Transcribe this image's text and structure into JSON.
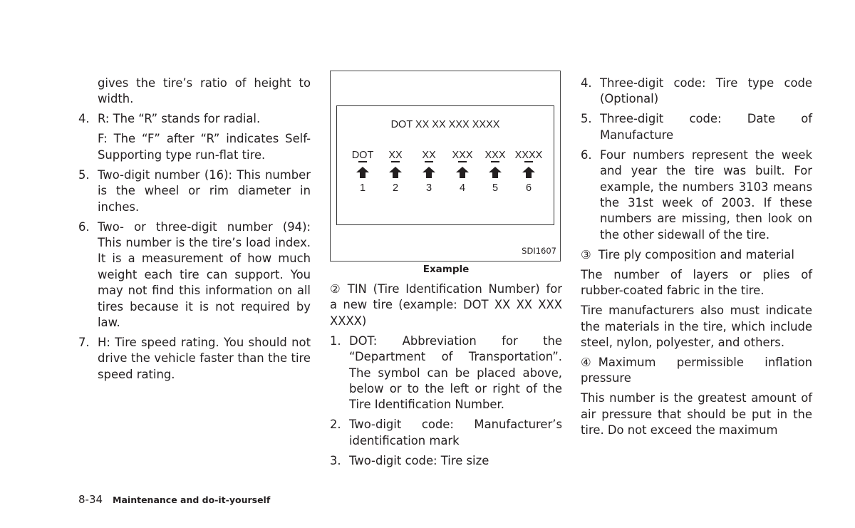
{
  "left_column": {
    "intro_continuation": "gives the tire’s ratio of height to width.",
    "items": [
      {
        "num": "4.",
        "text": "R: The “R” stands for radial.",
        "extra": "F: The “F” after “R” indicates Self-Supporting type run-flat tire."
      },
      {
        "num": "5.",
        "text": "Two-digit number (16): This number is the wheel or rim diameter in inches."
      },
      {
        "num": "6.",
        "text": "Two- or three-digit number (94): This number is the tire’s load index. It is a measurement of how much weight each tire can support. You may not find this information on all tires because it is not required by law."
      },
      {
        "num": "7.",
        "text": "H: Tire speed rating. You should not drive the vehicle faster than the tire speed rating."
      }
    ]
  },
  "figure": {
    "code_line": "DOT XX XX XXX XXXX",
    "segments": [
      {
        "label": "DOT",
        "num": "1",
        "icon": "up-arrow-icon"
      },
      {
        "label": "XX",
        "num": "2",
        "icon": "up-arrow-icon"
      },
      {
        "label": "XX",
        "num": "3",
        "icon": "up-arrow-icon"
      },
      {
        "label": "XXX",
        "num": "4",
        "icon": "up-arrow-icon"
      },
      {
        "label": "XXX",
        "num": "5",
        "icon": "up-arrow-icon"
      },
      {
        "label": "XXXX",
        "num": "6",
        "icon": "up-arrow-icon"
      }
    ],
    "figure_id": "SDI1607",
    "caption": "Example"
  },
  "middle_column": {
    "heading_marker": "②",
    "heading": "TIN (Tire Identification Number) for a new tire (example: DOT XX XX XXX XXXX)",
    "items": [
      {
        "num": "1.",
        "text": "DOT: Abbreviation for the “Department of Transportation”. The symbol can be placed above, below or to the left or right of the Tire Identification Number."
      },
      {
        "num": "2.",
        "text": "Two-digit code: Manufacturer’s identification mark"
      },
      {
        "num": "3.",
        "text": "Two-digit code: Tire size"
      }
    ]
  },
  "right_column": {
    "items": [
      {
        "num": "4.",
        "text": "Three-digit code: Tire type code (Optional)"
      },
      {
        "num": "5.",
        "text": "Three-digit code: Date of Manufacture"
      },
      {
        "num": "6.",
        "text": "Four numbers represent the week and year the tire was built. For example, the numbers 3103 means the 31st week of 2003. If these numbers are missing, then look on the other sidewall of the tire."
      }
    ],
    "section3": {
      "marker": "③",
      "heading": "Tire ply composition and material",
      "paragraphs": [
        "The number of layers or plies of rubber-coated fabric in the tire.",
        "Tire manufacturers also must indicate the materials in the tire, which include steel, nylon, polyester, and others."
      ]
    },
    "section4": {
      "marker": "④",
      "heading": "Maximum permissible inflation pressure",
      "paragraphs": [
        "This number is the greatest amount of air pressure that should be put in the tire. Do not exceed the maximum"
      ]
    }
  },
  "footer": {
    "page_number": "8-34",
    "section_title": "Maintenance and do-it-yourself"
  }
}
